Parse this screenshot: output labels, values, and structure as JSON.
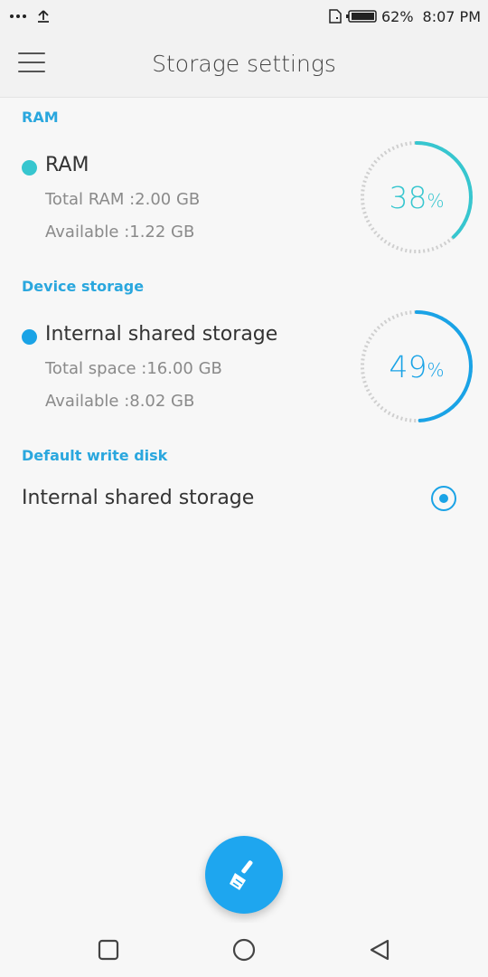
{
  "status_bar": {
    "icons_left": [
      "more-dots-icon",
      "upload-icon"
    ],
    "icons_right": [
      "sim-icon",
      "battery-icon"
    ],
    "battery": "62%",
    "time": "8:07 PM"
  },
  "app_bar": {
    "title": "Storage settings",
    "menu_icon": "hamburger-menu-icon"
  },
  "ram_section": {
    "header": "RAM",
    "item": {
      "name": "RAM",
      "total": "Total RAM :2.00 GB",
      "available": "Available :1.22 GB",
      "percent_value": "38",
      "percent_sign": "%",
      "fraction_used": 0.38,
      "color": "#37c6cf"
    }
  },
  "device_section": {
    "header": "Device storage",
    "item": {
      "name": "Internal shared storage",
      "total": "Total space :16.00 GB",
      "available": "Available :8.02 GB",
      "percent_value": "49",
      "percent_sign": "%",
      "fraction_used": 0.49,
      "color": "#1aa3e6"
    }
  },
  "write_section": {
    "header": "Default write disk",
    "option_label": "Internal shared storage",
    "selected": true
  },
  "fab": {
    "icon": "broom-clean-icon"
  },
  "nav_bar": {
    "recent_icon": "square-recents-icon",
    "home_icon": "circle-home-icon",
    "back_icon": "triangle-back-icon"
  }
}
